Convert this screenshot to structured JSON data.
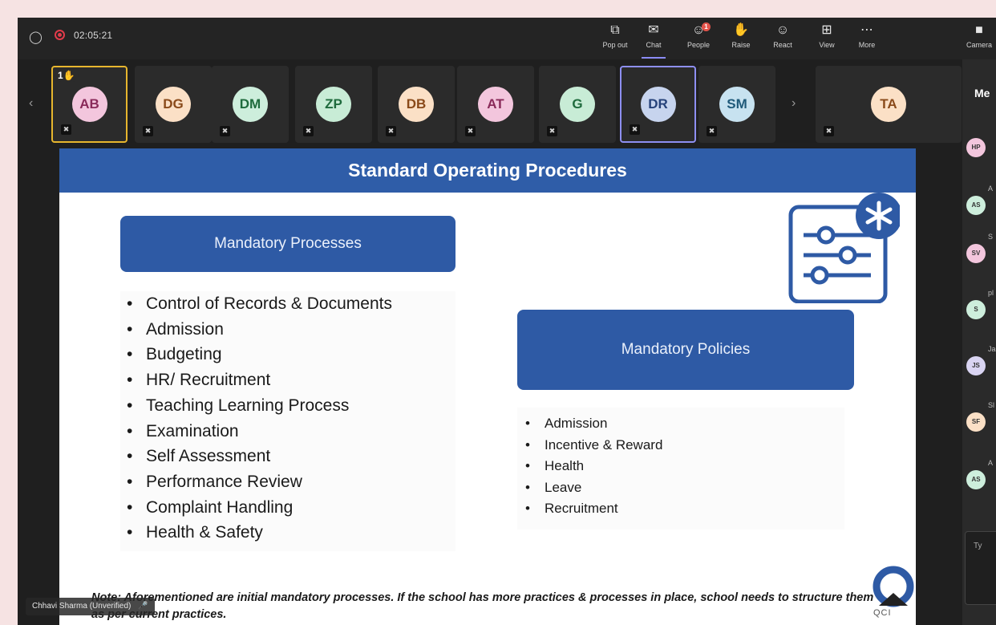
{
  "meeting": {
    "timer": "02:05:21",
    "toolbar": [
      {
        "name": "popout",
        "label": "Pop out",
        "icon": "popout-icon"
      },
      {
        "name": "chat",
        "label": "Chat",
        "icon": "chat-icon",
        "active": true
      },
      {
        "name": "people",
        "label": "People",
        "icon": "people-icon",
        "badge": "1"
      },
      {
        "name": "raise",
        "label": "Raise",
        "icon": "raise-hand-icon"
      },
      {
        "name": "react",
        "label": "React",
        "icon": "smiley-icon"
      },
      {
        "name": "view",
        "label": "View",
        "icon": "grid-icon"
      },
      {
        "name": "more",
        "label": "More",
        "icon": "ellipsis-icon"
      },
      {
        "name": "camera",
        "label": "Camera",
        "icon": "camera-off-icon"
      }
    ]
  },
  "participants": [
    {
      "initials": "AB",
      "bg": "#f3c6dd",
      "fg": "#8a2a5a",
      "hand": "1"
    },
    {
      "initials": "DG",
      "bg": "#fbe0c6",
      "fg": "#8a4a1a"
    },
    {
      "initials": "DM",
      "bg": "#cdeedc",
      "fg": "#1f6b3d"
    },
    {
      "initials": "ZP",
      "bg": "#c8ecd6",
      "fg": "#1f6b3d"
    },
    {
      "initials": "DB",
      "bg": "#fbe0c6",
      "fg": "#8a4a1a"
    },
    {
      "initials": "AT",
      "bg": "#f3c6dd",
      "fg": "#8a2a5a"
    },
    {
      "initials": "G",
      "bg": "#c8ecd6",
      "fg": "#1f6b3d"
    },
    {
      "initials": "DR",
      "bg": "#c7d4ee",
      "fg": "#26427a"
    },
    {
      "initials": "SM",
      "bg": "#c7e2f0",
      "fg": "#1f5a7a"
    },
    {
      "initials": "TA",
      "bg": "#fbe0c6",
      "fg": "#8a4a1a"
    }
  ],
  "slide": {
    "title": "Standard Operating Procedures",
    "processes_heading": "Mandatory Processes",
    "processes": [
      "Control of Records & Documents",
      "Admission",
      "Budgeting",
      "HR/ Recruitment",
      "Teaching Learning Process",
      "Examination",
      "Self Assessment",
      "Performance Review",
      "Complaint Handling",
      "Health & Safety"
    ],
    "policies_heading": "Mandatory Policies",
    "policies": [
      "Admission",
      "Incentive & Reward",
      "Health",
      "Leave",
      "Recruitment"
    ],
    "note": "Note: Aforementioned are initial mandatory processes. If the school has more practices & processes in place, school needs to structure them as per current practices.",
    "logo": "QCI"
  },
  "presenter_tag": "Chhavi Sharma (Unverified)",
  "side_panel": {
    "title": "Me",
    "people": [
      {
        "initials": "HP",
        "bg": "#f3c6dd",
        "label": ""
      },
      {
        "initials": "AS",
        "bg": "#cdeedc",
        "label": "A"
      },
      {
        "initials": "SV",
        "bg": "#f3c6dd",
        "label": "S"
      },
      {
        "initials": "S",
        "bg": "#cdeedc",
        "label": "pl"
      },
      {
        "initials": "JS",
        "bg": "#d9d4f2",
        "label": "Ja"
      },
      {
        "initials": "SF",
        "bg": "#fbe0c6",
        "label": "Sl"
      },
      {
        "initials": "AS",
        "bg": "#cdeedc",
        "label": "A"
      }
    ],
    "input_placeholder": "Ty"
  }
}
